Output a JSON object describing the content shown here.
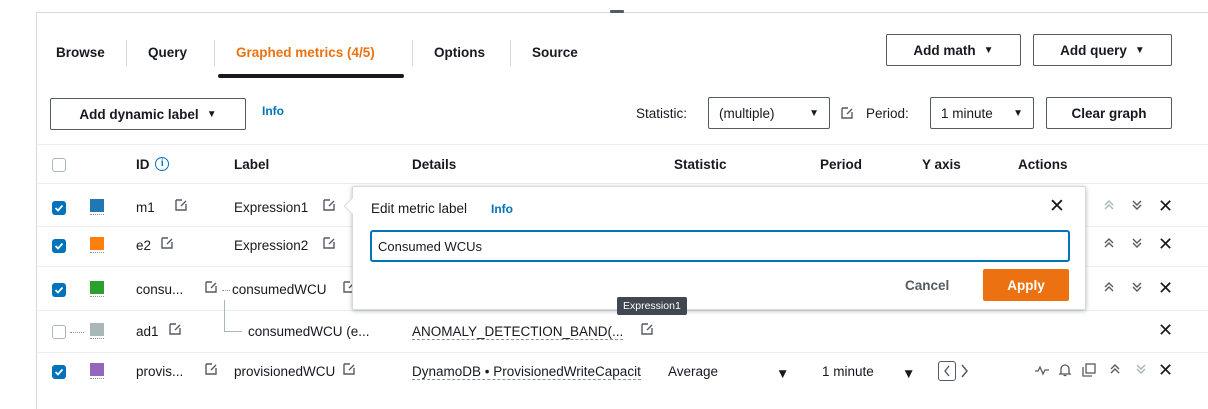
{
  "tabs": [
    {
      "label": "Browse"
    },
    {
      "label": "Query"
    },
    {
      "label": "Graphed metrics (4/5)"
    },
    {
      "label": "Options"
    },
    {
      "label": "Source"
    }
  ],
  "top_buttons": {
    "add_math": "Add math",
    "add_query": "Add query"
  },
  "toolbar": {
    "add_dynamic_label": "Add dynamic label",
    "info": "Info",
    "statistic_label": "Statistic:",
    "statistic_value": "(multiple)",
    "period_label": "Period:",
    "period_value": "1 minute",
    "clear_graph": "Clear graph"
  },
  "table": {
    "headers": {
      "id": "ID",
      "label": "Label",
      "details": "Details",
      "statistic": "Statistic",
      "period": "Period",
      "y_axis": "Y axis",
      "actions": "Actions"
    },
    "rows": [
      {
        "id": "m1",
        "label": "Expression1",
        "details": "",
        "statistic": "",
        "period": "",
        "checked": true,
        "color": "#1f77b4"
      },
      {
        "id": "e2",
        "label": "Expression2",
        "details": "",
        "statistic": "",
        "period": "",
        "checked": true,
        "color": "#ff7f0e"
      },
      {
        "id": "consu...",
        "label": "consumedWCU",
        "details": "",
        "statistic": "",
        "period": "",
        "checked": true,
        "color": "#2ca02c"
      },
      {
        "id": "ad1",
        "label": "consumedWCU (e...",
        "details": "ANOMALY_DETECTION_BAND(...",
        "statistic": "",
        "period": "",
        "checked": false,
        "color": "#7f7f7f"
      },
      {
        "id": "provis...",
        "label": "provisionedWCU",
        "details": "DynamoDB • ProvisionedWriteCapacit",
        "statistic": "Average",
        "period": "1 minute",
        "checked": true,
        "color": "#9467bd"
      }
    ]
  },
  "popover": {
    "title": "Edit metric label",
    "info": "Info",
    "input_value": "Consumed WCUs",
    "cancel": "Cancel",
    "apply": "Apply"
  },
  "tooltip": "Expression1",
  "colors": {
    "accent_orange": "#ec7211",
    "link_blue": "#0073bb",
    "checkbox_blue": "#0073bb"
  }
}
